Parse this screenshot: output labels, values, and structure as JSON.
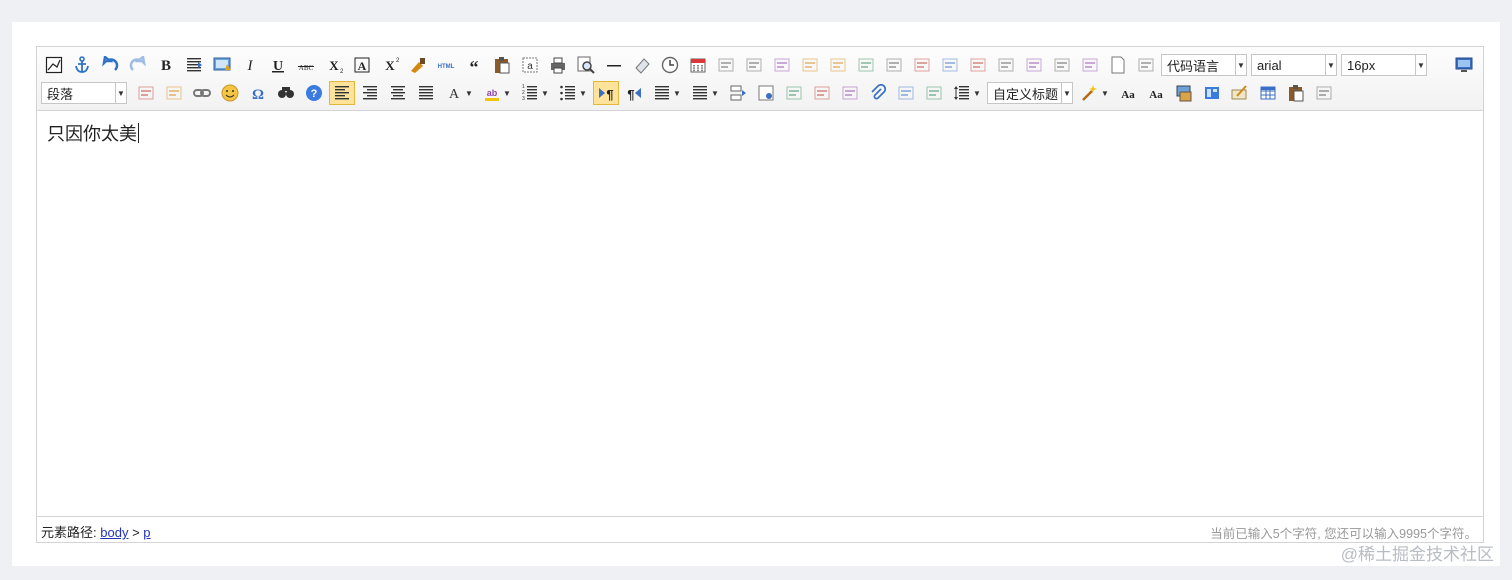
{
  "toolbar": {
    "row1_buttons": [
      {
        "name": "source-icon"
      },
      {
        "name": "anchor-icon"
      },
      {
        "name": "undo-icon"
      },
      {
        "name": "redo-icon",
        "disabled": true
      },
      {
        "name": "bold-icon"
      },
      {
        "name": "indent-icon"
      },
      {
        "name": "snapscreen-icon"
      },
      {
        "name": "italic-icon"
      },
      {
        "name": "underline-icon"
      },
      {
        "name": "strikethrough-icon"
      },
      {
        "name": "subscript-icon"
      },
      {
        "name": "fontborder-icon"
      },
      {
        "name": "superscript-icon"
      },
      {
        "name": "formatmatch-icon"
      },
      {
        "name": "html-icon"
      },
      {
        "name": "blockquote-icon"
      },
      {
        "name": "pasteplain-icon"
      },
      {
        "name": "selectall-icon"
      },
      {
        "name": "print-icon"
      },
      {
        "name": "preview-icon"
      },
      {
        "name": "horizontal-rule-icon"
      },
      {
        "name": "eraser-icon"
      },
      {
        "name": "time-icon"
      },
      {
        "name": "date-icon"
      },
      {
        "name": "unlink-icon",
        "disabled": true
      },
      {
        "name": "insertrow-icon",
        "disabled": true
      },
      {
        "name": "insertcol-icon",
        "disabled": true
      },
      {
        "name": "mergeright-icon",
        "disabled": true
      },
      {
        "name": "mergedown-icon",
        "disabled": true
      },
      {
        "name": "deleterow-icon",
        "disabled": true
      },
      {
        "name": "deletecol-icon",
        "disabled": true
      },
      {
        "name": "splittorows-icon",
        "disabled": true
      },
      {
        "name": "splittocols-icon",
        "disabled": true
      },
      {
        "name": "splittocells-icon",
        "disabled": true
      },
      {
        "name": "deletecaption-icon",
        "disabled": true
      },
      {
        "name": "inserttitle-icon",
        "disabled": true
      },
      {
        "name": "mergecells-icon",
        "disabled": true
      },
      {
        "name": "deletetable-icon",
        "disabled": true
      },
      {
        "name": "cleardoc-icon"
      },
      {
        "name": "insertparagraph-icon",
        "disabled": true
      }
    ],
    "code_language": "代码语言",
    "font_family": "arial",
    "font_size": "16px",
    "paragraph": "段落",
    "custom_title": "自定义标题",
    "row2_buttons_a": [
      {
        "name": "edittable-icon",
        "disabled": true
      },
      {
        "name": "edittd-icon",
        "disabled": true
      },
      {
        "name": "link-icon"
      },
      {
        "name": "emotion-icon"
      },
      {
        "name": "spechars-icon"
      },
      {
        "name": "searchreplace-icon"
      },
      {
        "name": "help-icon"
      },
      {
        "name": "justifyleft-icon",
        "active": true
      },
      {
        "name": "justifyright-icon"
      },
      {
        "name": "justifycenter-icon"
      },
      {
        "name": "justifyjustify-icon"
      }
    ],
    "row2_dd_a": [
      {
        "name": "forecolor-icon"
      },
      {
        "name": "backcolor-icon"
      },
      {
        "name": "insertorderedlist-icon"
      },
      {
        "name": "insertunorderedlist-icon"
      }
    ],
    "row2_buttons_b": [
      {
        "name": "directionalityltr-icon",
        "active": true
      },
      {
        "name": "directionalityrtl-icon"
      }
    ],
    "row2_dd_b": [
      {
        "name": "rowspacingtop-icon"
      },
      {
        "name": "rowspacingbottom-icon"
      }
    ],
    "row2_buttons_c": [
      {
        "name": "pagebreak-icon"
      },
      {
        "name": "insertframe-icon"
      },
      {
        "name": "imagenone-icon",
        "disabled": true
      },
      {
        "name": "imageleft-icon",
        "disabled": true
      },
      {
        "name": "imageright-icon",
        "disabled": true
      },
      {
        "name": "attachment-icon"
      },
      {
        "name": "imagecenter-icon",
        "disabled": true
      },
      {
        "name": "wordimage-icon",
        "disabled": true
      }
    ],
    "row2_dd_c": [
      {
        "name": "lineheight-icon"
      }
    ],
    "row2_dd_d": [
      {
        "name": "autotypeset-icon"
      }
    ],
    "row2_buttons_d": [
      {
        "name": "touppercase-icon"
      },
      {
        "name": "tolowercase-icon"
      },
      {
        "name": "background-icon"
      },
      {
        "name": "template-icon"
      },
      {
        "name": "scrawl-icon"
      },
      {
        "name": "inserttable-icon"
      },
      {
        "name": "paste-icon"
      },
      {
        "name": "charts-icon",
        "disabled": true
      }
    ],
    "fullscreen": {
      "name": "fullscreen-icon"
    }
  },
  "content": {
    "paragraph_text": "只因你太美"
  },
  "status_bar": {
    "path_label": "元素路径:",
    "path_body": "body",
    "path_sep": ">",
    "path_p": "p",
    "word_count": "当前已输入5个字符, 您还可以输入9995个字符。"
  },
  "watermark": "@稀土掘金技术社区"
}
